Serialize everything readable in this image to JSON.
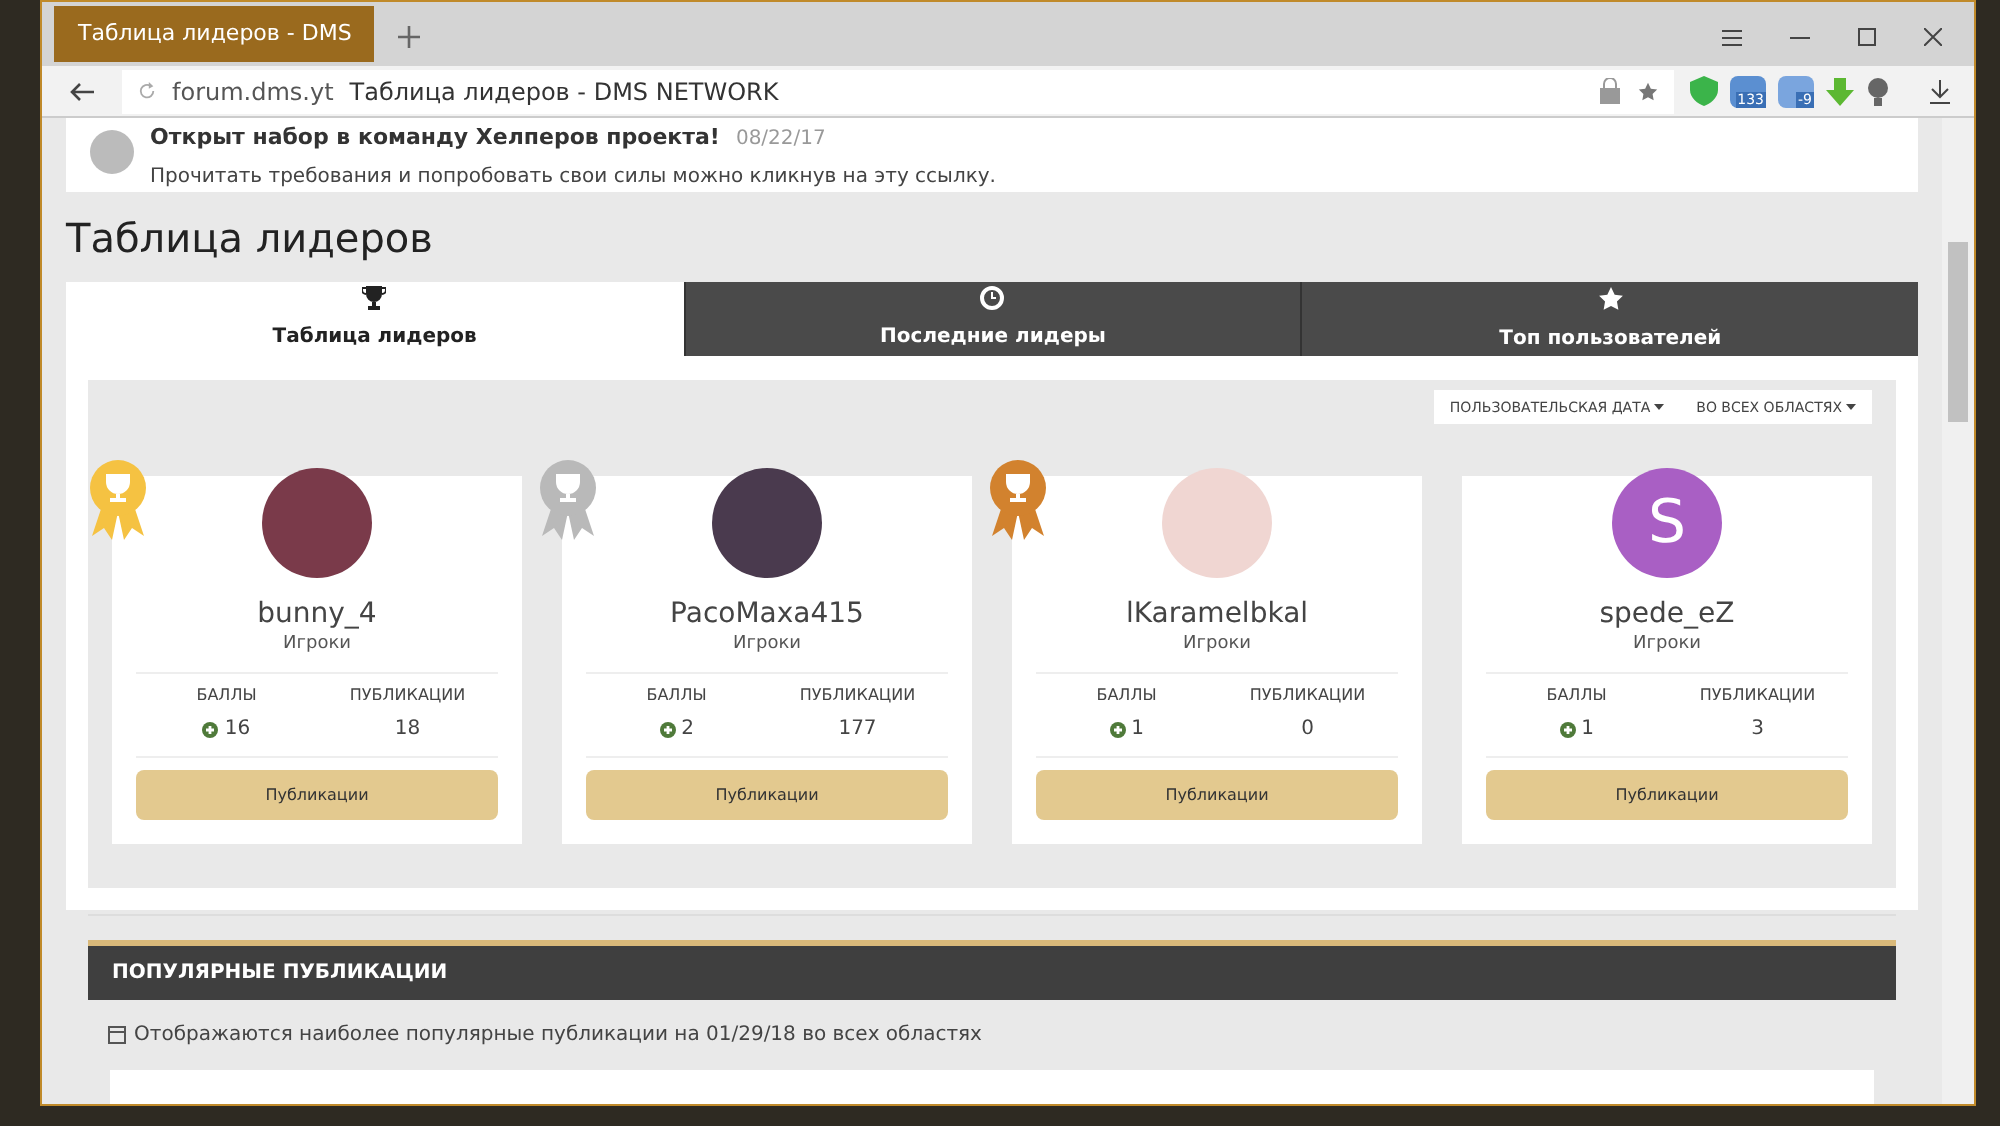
{
  "browser": {
    "tab_title": "Таблица лидеров - DMS",
    "url_host": "forum.dms.yt",
    "url_title": "Таблица лидеров - DMS NETWORK",
    "badges": [
      "133",
      "-9"
    ]
  },
  "notice": {
    "title": "Открыт набор в команду Хелперов проекта!",
    "date": "08/22/17",
    "text": "Прочитать требования и попробовать свои силы можно кликнув на эту ссылку."
  },
  "heading": "Таблица лидеров",
  "tabs": [
    {
      "kind": "trophy",
      "label": "Таблица лидеров",
      "selected": true
    },
    {
      "kind": "clock",
      "label": "Последние лидеры",
      "selected": false
    },
    {
      "kind": "star",
      "label": "Топ пользователей",
      "selected": false
    }
  ],
  "filters": [
    "ПОЛЬЗОВАТЕЛЬСКАЯ ДАТА",
    "ВО ВСЕХ ОБЛАСТЯХ"
  ],
  "leaders": [
    {
      "color": "#f5c242",
      "avatar": {
        "kind": "photo",
        "color": "#7a3a4a"
      },
      "name": "bunny_4",
      "group": "Игроки",
      "points_label": "БАЛЛЫ",
      "points": "16",
      "posts_label": "ПУБЛИКАЦИИ",
      "posts": "18",
      "button": "Публикации"
    },
    {
      "color": "#b9b9b9",
      "avatar": {
        "kind": "photo",
        "color": "#4a3a4e"
      },
      "name": "PacoMaxa415",
      "group": "Игроки",
      "points_label": "БАЛЛЫ",
      "points": "2",
      "posts_label": "ПУБЛИКАЦИИ",
      "posts": "177",
      "button": "Публикации"
    },
    {
      "color": "#d2822e",
      "avatar": {
        "kind": "photo",
        "color": "#f0d6d2"
      },
      "name": "lKaramelbkal",
      "group": "Игроки",
      "points_label": "БАЛЛЫ",
      "points": "1",
      "posts_label": "ПУБЛИКАЦИИ",
      "posts": "0",
      "button": "Публикации"
    },
    {
      "avatar": {
        "kind": "letter",
        "letter": "S",
        "color": "#a95fc4"
      },
      "name": "spede_eZ",
      "group": "Игроки",
      "points_label": "БАЛЛЫ",
      "points": "1",
      "posts_label": "ПУБЛИКАЦИИ",
      "posts": "3",
      "button": "Публикации"
    }
  ],
  "popular": {
    "title": "ПОПУЛЯРНЫЕ ПУБЛИКАЦИИ",
    "info": "Отображаются наиболее популярные публикации на 01/29/18 во всех областях"
  }
}
